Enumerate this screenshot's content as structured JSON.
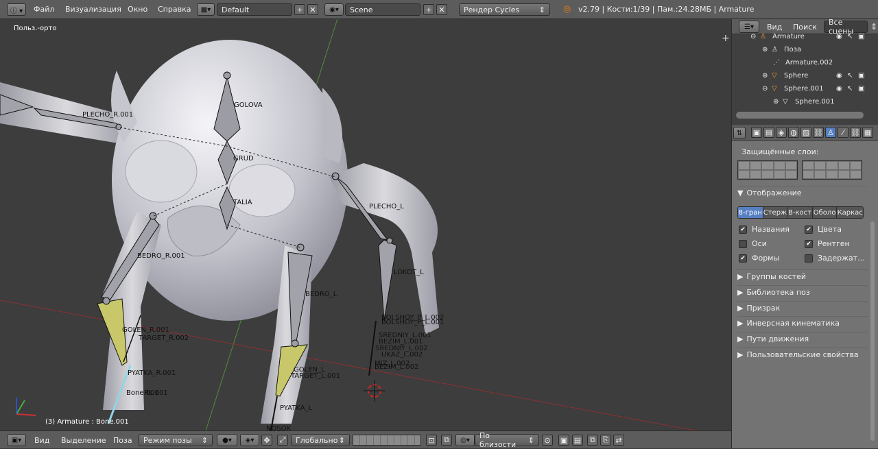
{
  "header": {
    "menu": [
      "Файл",
      "Визуализация",
      "Окно",
      "Справка"
    ],
    "screen_layout": "Default",
    "scene": "Scene",
    "render_engine": "Рендер Cycles",
    "stats": "v2.79 | Кости:1/39 | Пам.:24.28МБ | Armature"
  },
  "viewport": {
    "view_label": "Польз.-орто",
    "status_text": "(3) Armature : Bone.001",
    "bones": [
      "PLECHO_R.001",
      "GOLOVA",
      "GRUD",
      "TALIA",
      "PLECHO_L",
      "BEDRO_R.001",
      "BEDRO_L",
      "LOKOT_L",
      "GOLEN_R.001",
      "TARGET_R.002",
      "PYATKA_R.001",
      "Bone.001",
      "GOLEN_L",
      "TARGET_L.001",
      "PYATKA_L",
      "BOLSHOY_P_L.002",
      "BOLSHOY_P_L.001",
      "SREDNIY_L.001",
      "SREDNIY_L.002",
      "MIZ_L.002",
      "BEZIM_L.002",
      "BEZIM_L.001",
      "UKAZ_L.002",
      "NOSOK",
      "RL.001"
    ]
  },
  "outliner": {
    "view": "Вид",
    "search": "Поиск",
    "filter": "Все сцены",
    "rows": [
      "Armature",
      "Поза",
      "Armature.002",
      "Sphere",
      "Sphere.001",
      "Sphere.001"
    ]
  },
  "properties": {
    "protected_layers": "Защищённые слои:",
    "display": "Отображение",
    "display_modes": [
      "8-гран",
      "Стерж",
      "В-кост",
      "Оболо",
      "Каркас"
    ],
    "display_modes_active_index": 0,
    "checks": [
      {
        "label": "Названия",
        "checked": true
      },
      {
        "label": "Цвета",
        "checked": true
      },
      {
        "label": "Оси",
        "checked": false
      },
      {
        "label": "Рентген",
        "checked": true
      },
      {
        "label": "Формы",
        "checked": true
      },
      {
        "label": "Задержат...",
        "checked": false
      }
    ],
    "panels": [
      "Группы костей",
      "Библиотека поз",
      "Призрак",
      "Инверсная кинематика",
      "Пути движения",
      "Пользовательские свойства"
    ]
  },
  "footer": {
    "view": "Вид",
    "select": "Выделение",
    "pose": "Поза",
    "mode": "Режим позы",
    "orientation": "Глобально",
    "pivot": "По близости"
  },
  "colors": {
    "header_bg": "#5c5c5c",
    "viewport_bg": "#3d3d3d",
    "active_blue": "#5680c2",
    "bone_yellow": "#c8c86a"
  }
}
